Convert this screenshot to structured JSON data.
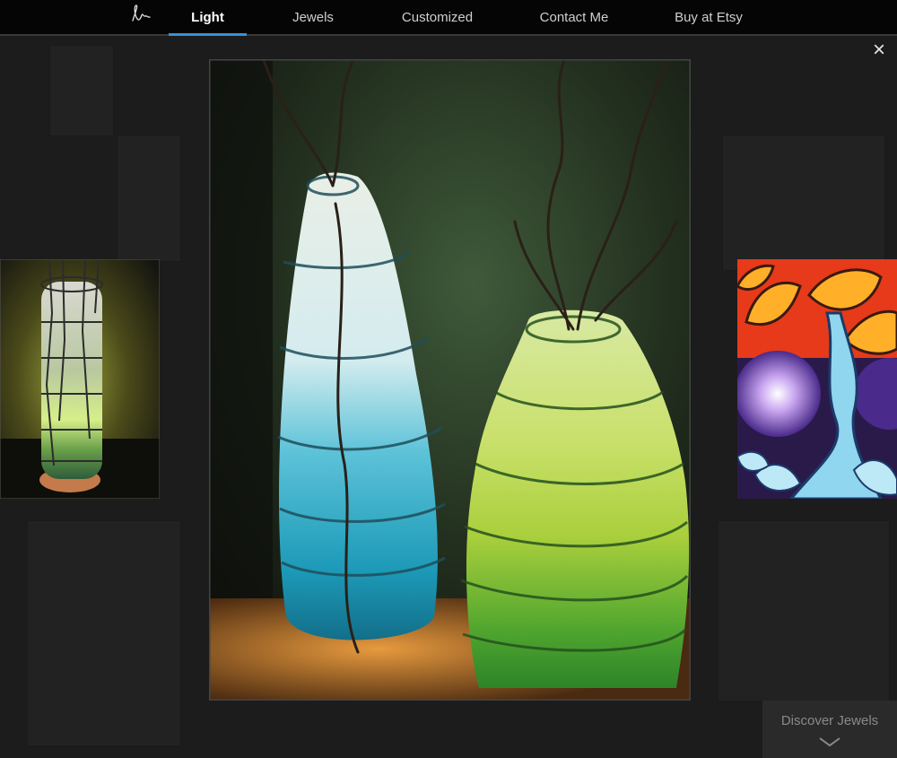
{
  "nav": {
    "logo_text": "Lm",
    "items": [
      {
        "label": "Light",
        "active": true
      },
      {
        "label": "Jewels",
        "active": false
      },
      {
        "label": "Customized",
        "active": false
      },
      {
        "label": "Contact Me",
        "active": false
      },
      {
        "label": "Buy at Etsy",
        "active": false
      }
    ]
  },
  "gallery": {
    "close_symbol": "×",
    "main_image": "paper-lanterns-blue-green",
    "prev_image": "tall-cylinder-lamp",
    "next_image": "tree-painting"
  },
  "discover": {
    "label": "Discover Jewels",
    "icon": "chevron-down-icon"
  },
  "colors": {
    "nav_bg": "#050505",
    "accent": "#3a8fd4",
    "page_bg": "#1c1c1c"
  }
}
